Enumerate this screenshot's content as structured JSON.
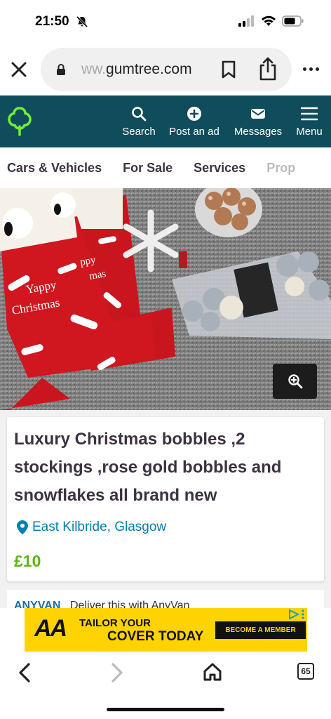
{
  "status": {
    "time": "21:50"
  },
  "browser": {
    "url_faded": "ww.",
    "url_main": "gumtree.com",
    "tab_count": "65"
  },
  "header": {
    "nav": [
      {
        "label": "Search",
        "icon": "search-icon"
      },
      {
        "label": "Post an ad",
        "icon": "plus-icon"
      },
      {
        "label": "Messages",
        "icon": "envelope-icon"
      },
      {
        "label": "Menu",
        "icon": "hamburger-icon"
      }
    ]
  },
  "categories": [
    "Cars & Vehicles",
    "For Sale",
    "Services",
    "Prop"
  ],
  "listing": {
    "title": "Luxury Christmas bobbles ,2 stockings ,rose gold bobbles and snowflakes all brand new",
    "location": "East Kilbride, Glasgow",
    "price": "£10",
    "photo_text_1": "Yappy",
    "photo_text_2": "Christmas",
    "photo_text_3": "ppy",
    "photo_text_4": "mas"
  },
  "promo": {
    "logo": "ANYVAN",
    "text": "Deliver this with AnyVan"
  },
  "banner": {
    "logo": "AA",
    "line1": "TAILOR YOUR",
    "line2": "COVER TODAY",
    "cta": "BECOME A MEMBER"
  },
  "colors": {
    "brand": "#0f4d5c",
    "logo_green": "#72ef36",
    "location": "#007fb0",
    "price": "#5cb615",
    "banner_yellow": "#ffd300"
  }
}
